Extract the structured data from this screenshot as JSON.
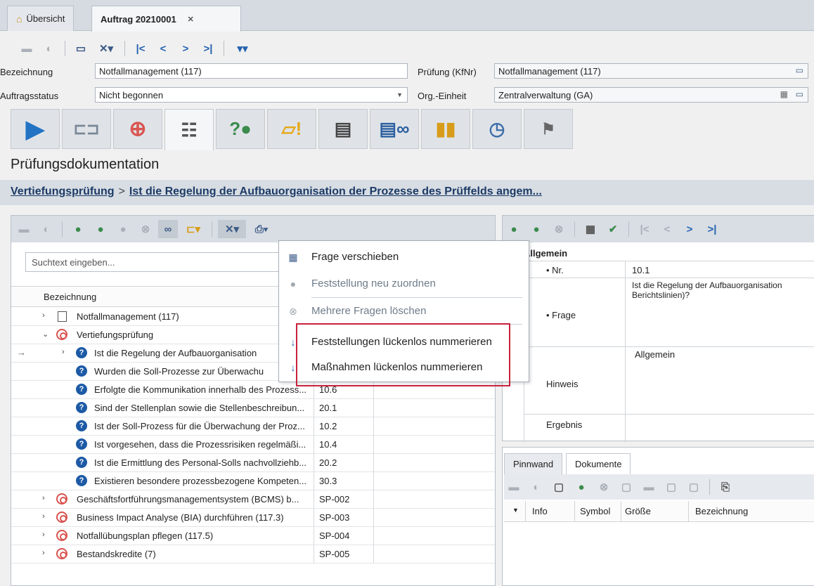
{
  "tabs": [
    {
      "label": "Übersicht"
    },
    {
      "label": "Auftrag 20210001"
    }
  ],
  "form": {
    "bezeichnung_label": "Bezeichnung",
    "bezeichnung_value": "Notfallmanagement (117)",
    "pruefung_label": "Prüfung (KfNr)",
    "pruefung_value": "Notfallmanagement (117)",
    "status_label": "Auftragsstatus",
    "status_value": "Nicht begonnen",
    "org_label": "Org.-Einheit",
    "org_value": "Zentralverwaltung (GA)"
  },
  "section": {
    "title": "Prüfungsdokumentation",
    "crumb1": "Vertiefungsprüfung",
    "crumb_sep": ">",
    "crumb2": "Ist die Regelung der Aufbauorganisation der Prozesse des Prüffelds angem..."
  },
  "left": {
    "search_placeholder": "Suchtext eingeben...",
    "col_header": "Bezeichnung",
    "rows": [
      {
        "text": "Notfallmanagement (117)",
        "nr": ""
      },
      {
        "text": "Vertiefungsprüfung",
        "nr": ""
      },
      {
        "text": "Ist die Regelung der Aufbauorganisation",
        "nr": "",
        "indicator": "→"
      },
      {
        "text": "Wurden die Soll-Prozesse zur Überwachu",
        "nr": ""
      },
      {
        "text": "Erfolgte die Kommunikation innerhalb des Prozess...",
        "nr": "10.6"
      },
      {
        "text": "Sind der Stellenplan sowie die Stellenbeschreibun...",
        "nr": "20.1"
      },
      {
        "text": "Ist der Soll-Prozess für die Überwachung der Proz...",
        "nr": "10.2"
      },
      {
        "text": "Ist vorgesehen, dass die Prozessrisiken regelmäßi...",
        "nr": "10.4"
      },
      {
        "text": "Ist die Ermittlung des Personal-Solls nachvollziehb...",
        "nr": "20.2"
      },
      {
        "text": "Existieren besondere prozessbezogene Kompeten...",
        "nr": "30.3"
      },
      {
        "text": "Geschäftsfortführungsmanagementsystem (BCMS) b...",
        "nr": "SP-002"
      },
      {
        "text": "Business Impact Analyse (BIA) durchführen (117.3)",
        "nr": "SP-003"
      },
      {
        "text": "Notfallübungsplan pflegen (117.5)",
        "nr": "SP-004"
      },
      {
        "text": "Bestandskredite (7)",
        "nr": "SP-005"
      }
    ]
  },
  "menu": {
    "items": [
      {
        "label": "Frage verschieben"
      },
      {
        "label": "Feststellung neu zuordnen"
      },
      {
        "label": "Mehrere Fragen löschen"
      },
      {
        "label": "Feststellungen lückenlos nummerieren"
      },
      {
        "label": "Maßnahmen lückenlos nummerieren"
      }
    ]
  },
  "right": {
    "group": "Allgemein",
    "nr_label": "• Nr.",
    "nr_value": "10.1",
    "frage_label": "• Frage",
    "frage_value": "Ist die Regelung der Aufbauorganisation Berichtslinien)?",
    "hinweis_label": "Hinweis",
    "hinweis_value": "Allgemein",
    "ergebnis_label": "Ergebnis"
  },
  "bottom": {
    "tabs": [
      "Pinnwand",
      "Dokumente"
    ],
    "cols": [
      "Info",
      "Symbol",
      "Größe",
      "Bezeichnung"
    ]
  },
  "colors": {
    "accent": "#1d5aa6",
    "highlight": "#c8223e",
    "target": "#d9534f"
  }
}
